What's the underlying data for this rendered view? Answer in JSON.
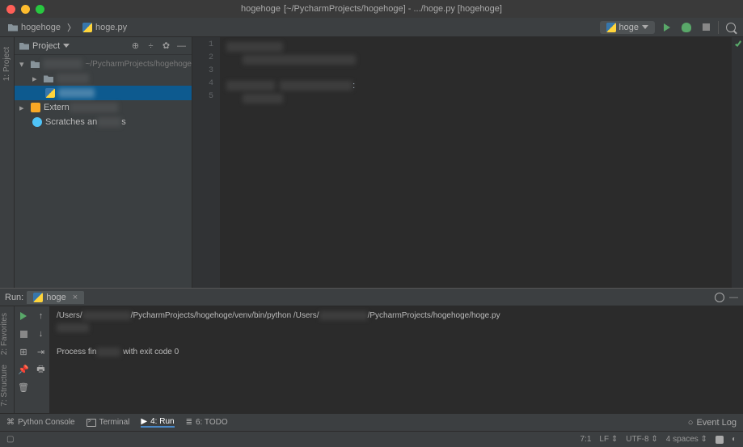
{
  "titlebar": {
    "project_name": "hogehoge",
    "path_suffix": "[~/PycharmProjects/hogehoge] - .../hoge.py [hogehoge]"
  },
  "toolbar": {
    "breadcrumb_root": "hogehoge",
    "breadcrumb_file": "hoge.py",
    "run_config": "hoge"
  },
  "sidebar": {
    "title": "Project",
    "root_path": "~/PycharmProjects/hogehoge",
    "external_libs": "External Libraries",
    "scratches": "Scratches and Consoles"
  },
  "left_tabs": {
    "project": "1: Project"
  },
  "run_left_tabs": {
    "favorites": "2: Favorites",
    "structure": "7: Structure"
  },
  "gutter": [
    "1",
    "2",
    "3",
    "4",
    "5"
  ],
  "run": {
    "label": "Run:",
    "tab": "hoge",
    "output_prefix": "/Users/",
    "output_mid1": "/PycharmProjects/hogehoge/venv/bin/python /Users/",
    "output_mid2": "/PycharmProjects/hogehoge/hoge.py",
    "finished_prefix": "Process fin",
    "finished_suffix": "with exit code 0"
  },
  "bottombar": {
    "python_console": "Python Console",
    "terminal": "Terminal",
    "run": "4: Run",
    "todo": "6: TODO",
    "event_log": "Event Log"
  },
  "statusbar": {
    "pos": "7:1",
    "lf": "LF",
    "encoding": "UTF-8",
    "spaces": "4 spaces"
  }
}
